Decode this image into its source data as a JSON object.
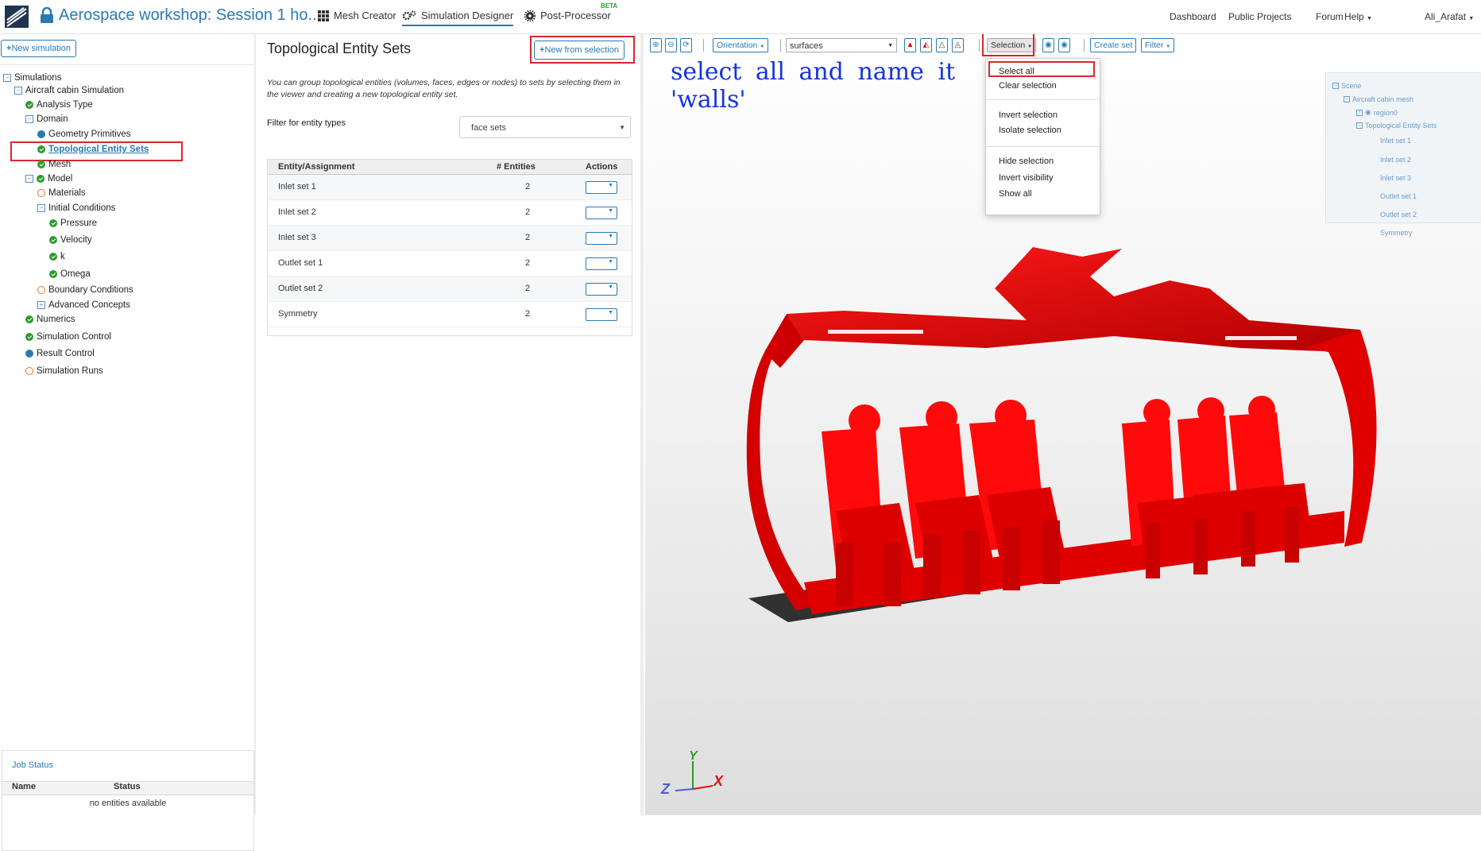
{
  "topbar": {
    "project_title": "Aerospace workshop: Session 1 ho...",
    "tabs": [
      {
        "label": "Mesh Creator",
        "icon": "grid-icon"
      },
      {
        "label": "Simulation Designer",
        "icon": "gears-icon",
        "active": true
      },
      {
        "label": "Post-Processor",
        "icon": "cog-icon",
        "badge": "BETA"
      }
    ],
    "right_links": [
      "Dashboard",
      "Public Projects",
      "Forum",
      "Help"
    ],
    "user": "Ali_Arafat"
  },
  "left": {
    "new_simulation_label": "New simulation",
    "tree": {
      "simulations": "Simulations",
      "aircraft_sim": "Aircraft cabin Simulation",
      "analysis_type": "Analysis Type",
      "domain": "Domain",
      "geometry_primitives": "Geometry Primitives",
      "topological_entity_sets": "Topological Entity Sets",
      "mesh": "Mesh",
      "model": "Model",
      "materials": "Materials",
      "initial_conditions": "Initial Conditions",
      "pressure": "Pressure",
      "velocity": "Velocity",
      "k": "k",
      "omega": "Omega",
      "boundary_conditions": "Boundary Conditions",
      "advanced_concepts": "Advanced Concepts",
      "numerics": "Numerics",
      "simulation_control": "Simulation Control",
      "result_control": "Result Control",
      "simulation_runs": "Simulation Runs"
    },
    "job_status": {
      "title": "Job Status",
      "col_name": "Name",
      "col_status": "Status",
      "empty": "no entities available"
    }
  },
  "middle": {
    "title": "Topological Entity Sets",
    "new_from_selection_label": "New from selection",
    "description": "You can group topological entities (volumes, faces, edges or nodes) to sets by selecting them in the viewer and creating a new topological entity set.",
    "filter_label": "Filter for entity types",
    "filter_value": "face sets",
    "table": {
      "headers": [
        "Entity/Assignment",
        "# Entities",
        "Actions"
      ],
      "rows": [
        {
          "name": "Inlet set 1",
          "count": "2"
        },
        {
          "name": "Inlet set 2",
          "count": "2"
        },
        {
          "name": "Inlet set 3",
          "count": "2"
        },
        {
          "name": "Outlet set 1",
          "count": "2"
        },
        {
          "name": "Outlet set 2",
          "count": "2"
        },
        {
          "name": "Symmetry",
          "count": "2"
        }
      ]
    }
  },
  "viewer": {
    "toolbar": {
      "orientation": "Orientation",
      "render_mode": "surfaces",
      "selection": "Selection",
      "create_set": "Create set",
      "filter": "Filter"
    },
    "selection_menu": [
      "Select all",
      "Clear selection",
      "Invert selection",
      "Isolate selection",
      "Hide selection",
      "Invert visibility",
      "Show all"
    ],
    "annotation": "select all and name it\n'walls'",
    "scene_tree": {
      "scene": "Scene",
      "mesh": "Aircraft cabin mesh",
      "region": "region0",
      "sets": "Topological Entity Sets",
      "items": [
        "Inlet set 1",
        "Inlet set 2",
        "Inlet set 3",
        "Outlet set 1",
        "Outlet set 2",
        "Symmetry"
      ]
    },
    "axes": {
      "x": "X",
      "y": "Y",
      "z": "Z"
    },
    "model_color": "#ee0000"
  }
}
